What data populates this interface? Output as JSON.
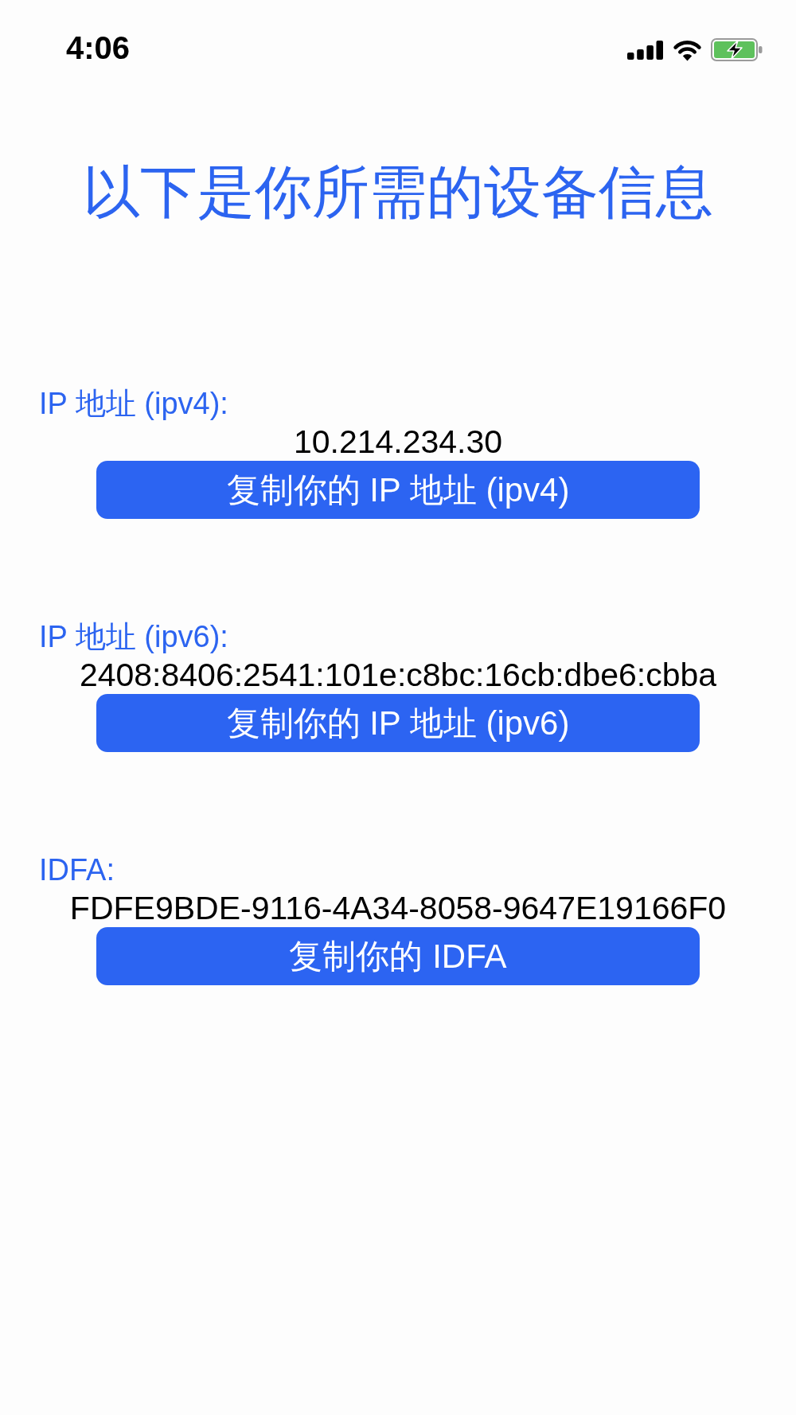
{
  "status_bar": {
    "time": "4:06",
    "battery_charging": true
  },
  "title": "以下是你所需的设备信息",
  "sections": [
    {
      "label": "IP 地址 (ipv4):",
      "value": "10.214.234.30",
      "button": "复制你的 IP 地址 (ipv4)"
    },
    {
      "label": "IP 地址 (ipv6):",
      "value": "2408:8406:2541:101e:c8bc:16cb:dbe6:cbba",
      "button": "复制你的 IP 地址 (ipv6)"
    },
    {
      "label": "IDFA:",
      "value": "FDFE9BDE-9116-4A34-8058-9647E19166F0",
      "button": "复制你的 IDFA"
    }
  ]
}
